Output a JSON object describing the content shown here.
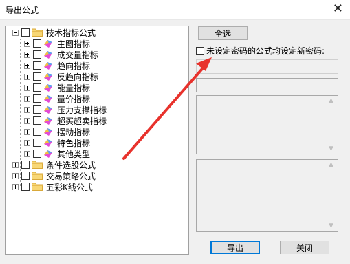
{
  "window": {
    "title": "导出公式",
    "close_glyph": "✕"
  },
  "tree": {
    "root": "技术指标公式",
    "children": [
      "主图指标",
      "成交量指标",
      "趋向指标",
      "反趋向指标",
      "能量指标",
      "量价指标",
      "压力支撑指标",
      "超买超卖指标",
      "摆动指标",
      "特色指标",
      "其他类型"
    ],
    "siblings": [
      "条件选股公式",
      "交易策略公式",
      "五彩K线公式"
    ]
  },
  "buttons": {
    "select_all": "全选",
    "export": "导出",
    "close": "关闭"
  },
  "password": {
    "label": "未设定密码的公式均设定新密码:",
    "value": ""
  },
  "accent": "#0078d7",
  "arrow_color": "#e8322c"
}
